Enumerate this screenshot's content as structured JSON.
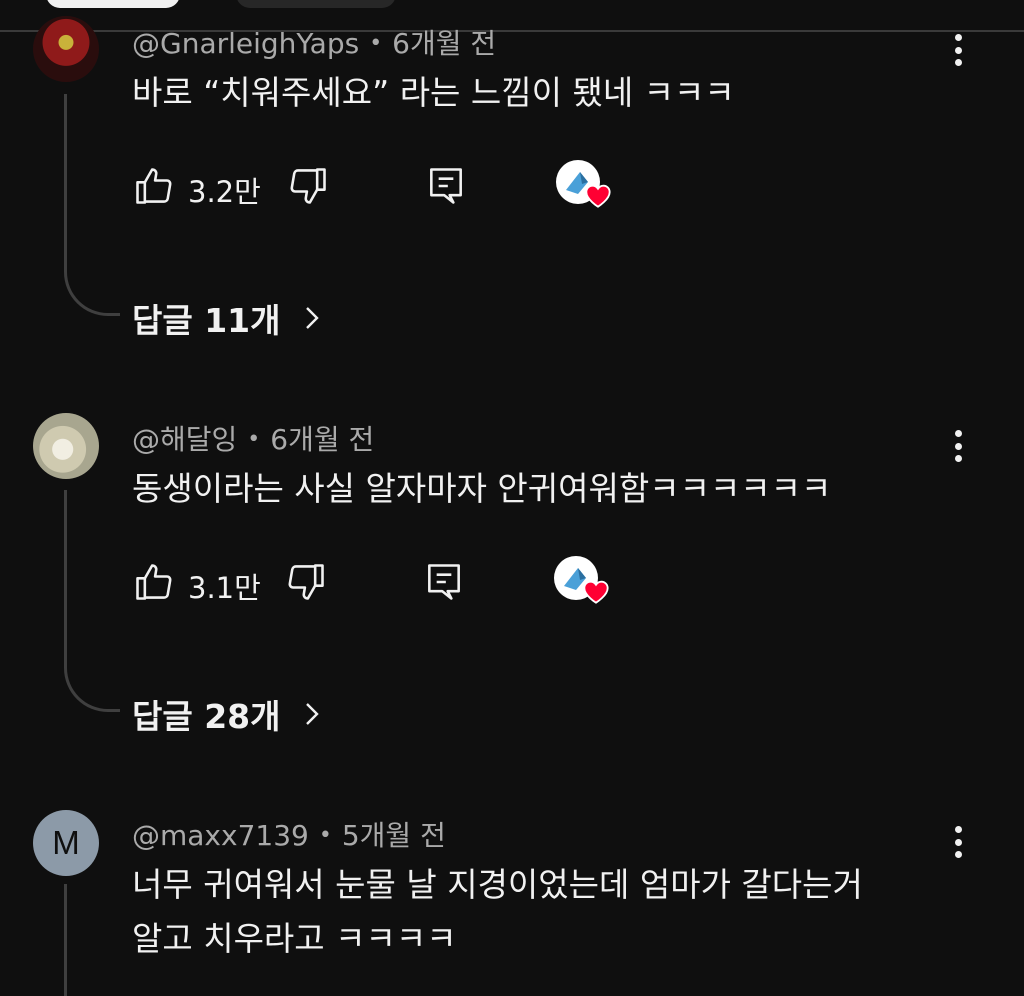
{
  "comments": [
    {
      "author": "@GnarleighYaps",
      "time": "6개월 전",
      "text": "바로 “치워주세요” 라는 느낌이 됐네 ㅋㅋㅋ",
      "likes": "3.2만",
      "replies": "답글 11개",
      "avatar_icon": "avatar-image"
    },
    {
      "author": "@해달잉",
      "time": "6개월 전",
      "text": "동생이라는 사실 알자마자 안귀여워함ㅋㅋㅋㅋㅋㅋ",
      "likes": "3.1만",
      "replies": "답글 28개",
      "avatar_icon": "avatar-image"
    },
    {
      "author": "@maxx7139",
      "time": "5개월 전",
      "text_line1": "너무 귀여워서 눈물 날 지경이었는데 엄마가 갈다는거",
      "text_line2": "알고 치우라고 ㅋㅋㅋㅋ",
      "avatar_letter": "M"
    }
  ],
  "icons": {
    "like": "thumbs-up-icon",
    "dislike": "thumbs-down-icon",
    "reply": "reply-icon",
    "more": "more-vert-icon",
    "creator_heart": "creator-heart-icon",
    "chevron": "chevron-right-icon"
  },
  "colors": {
    "background": "#0f0f0f",
    "text_primary": "#f1f1f1",
    "text_secondary": "#aaaaaa",
    "heart": "#ff0033",
    "thread": "#3f3f3f"
  }
}
